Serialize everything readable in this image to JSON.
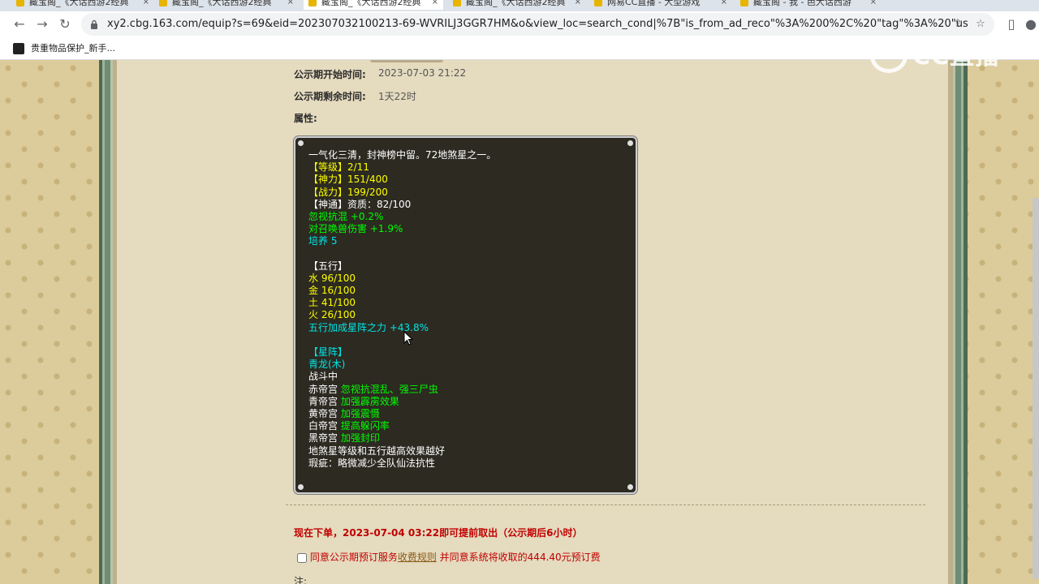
{
  "browser": {
    "tabs": [
      {
        "title": "藏宝阁_《大话西游2经典",
        "active": false
      },
      {
        "title": "藏宝阁_《大话西游2经典",
        "active": false
      },
      {
        "title": "藏宝阁_《大话西游2经典",
        "active": true
      },
      {
        "title": "藏宝阁_《大话西游2经典",
        "active": false
      },
      {
        "title": "网易CC直播 - 大型游戏",
        "active": false
      },
      {
        "title": "藏宝阁 - 我 - 芭大话西游",
        "active": false
      }
    ],
    "url": "xy2.cbg.163.com/equip?s=69&eid=202307032100213-69-WVRILJ3GGR7HM&o&view_loc=search_cond|%7B\"is_from_ad_reco\"%3A%200%2C%20\"tag\"%3A%20\"user\"%7...",
    "bookmark_label": "贵重物品保护_新手...",
    "watermark_text": "CC直播"
  },
  "listing": {
    "publicity_start_label": "公示期开始时间:",
    "publicity_start_value": "2023-07-03 21:22",
    "publicity_remaining_label": "公示期剩余时间:",
    "publicity_remaining_value": "1天22时",
    "attributes_label": "属性:"
  },
  "attributes": [
    {
      "text": "一气化三清，封神榜中留。72地煞星之一。",
      "color": "w"
    },
    {
      "text": "【等级】2/11",
      "color": "y"
    },
    {
      "text": "【神力】151/400",
      "color": "y"
    },
    {
      "text": "【战力】199/200",
      "color": "y"
    },
    {
      "text": "【神通】资质：82/100",
      "color": "w"
    },
    {
      "text": "忽视抗混 +0.2%",
      "color": "g"
    },
    {
      "text": "对召唤兽伤害 +1.9%",
      "color": "g"
    },
    {
      "text": "培养 5",
      "color": "c"
    },
    {
      "text": "",
      "color": "w"
    },
    {
      "text": "【五行】",
      "color": "w"
    },
    {
      "text": "水 96/100",
      "color": "y"
    },
    {
      "text": "金 16/100",
      "color": "y"
    },
    {
      "text": "土 41/100",
      "color": "y"
    },
    {
      "text": "火 26/100",
      "color": "y"
    },
    {
      "text": "五行加成星阵之力 +43.8%",
      "color": "c"
    },
    {
      "text": "",
      "color": "w"
    },
    {
      "text": "【星阵】",
      "color": "c"
    },
    {
      "text": "青龙(木)",
      "color": "c"
    },
    {
      "text": "战斗中",
      "color": "w"
    },
    {
      "prefix": "赤帝宫 ",
      "text": "忽视抗混乱、强三尸虫",
      "color": "g"
    },
    {
      "prefix": "青帝宫 ",
      "text": "加强霹雳效果",
      "color": "g"
    },
    {
      "prefix": "黄帝宫 ",
      "text": "加强震慑",
      "color": "g"
    },
    {
      "prefix": "白帝宫 ",
      "text": "提高躲闪率",
      "color": "g"
    },
    {
      "prefix": "黑帝宫 ",
      "text": "加强封印",
      "color": "g"
    },
    {
      "text": "地煞星等级和五行越高效果越好",
      "color": "w"
    },
    {
      "text": "瑕疵：略微减少全队仙法抗性",
      "color": "w"
    }
  ],
  "order": {
    "notice": "现在下单，2023-07-04 03:22即可提前取出（公示期后6小时）",
    "agree_prefix": "同意公示期预订服务",
    "agree_link": "收费规则",
    "agree_suffix": " 并同意系统将收取的444.40元预订费",
    "note_label": "注:"
  }
}
